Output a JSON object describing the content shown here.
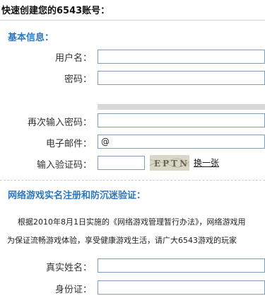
{
  "header": {
    "title": "快速创建您的6543账号："
  },
  "basic_section": {
    "title": "基本信息：",
    "username_label": "用户名：",
    "username_value": "",
    "password_label": "密码：",
    "password_value": "",
    "confirm_password_label": "再次输入密码：",
    "confirm_password_value": "",
    "email_label": "电子邮件：",
    "email_value": "@",
    "captcha_label": "输入验证码：",
    "captcha_value": "",
    "captcha_text": "EPTN",
    "change_captcha_link": "换一张"
  },
  "realname_section": {
    "title": "网络游戏实名注册和防沉迷验证：",
    "notice_line1": "根据2010年8月1日实施的《网络游戏管理暂行办法》，网络游戏用",
    "notice_line2": "为保证流畅游戏体验，享受健康游戏生活，请广大6543游戏的玩家",
    "real_name_label": "真实姓名：",
    "real_name_value": "",
    "id_card_label": "身份证：",
    "id_card_value": ""
  }
}
